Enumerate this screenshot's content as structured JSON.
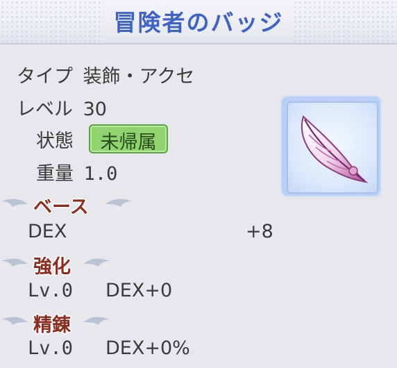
{
  "title": "冒険者のバッジ",
  "stats": {
    "type_label": "タイプ",
    "type_value": "装飾・アクセ",
    "level_label": "レベル",
    "level_value": "30",
    "state_label": "状態",
    "state_value": "未帰属",
    "weight_label": "重量",
    "weight_value": "1.0"
  },
  "base": {
    "heading": "ベース",
    "stat_name": "DEX",
    "stat_value": "+8"
  },
  "enhance": {
    "heading": "強化",
    "level": "Lv.0",
    "bonus": "DEX+0"
  },
  "refine": {
    "heading": "精錬",
    "level": "Lv.0",
    "bonus": "DEX+0%"
  },
  "item_icon": "feather-icon",
  "colors": {
    "title": "#3e62c8",
    "section_heading": "#8b2c1e",
    "badge_bg": "#8fd36f"
  }
}
